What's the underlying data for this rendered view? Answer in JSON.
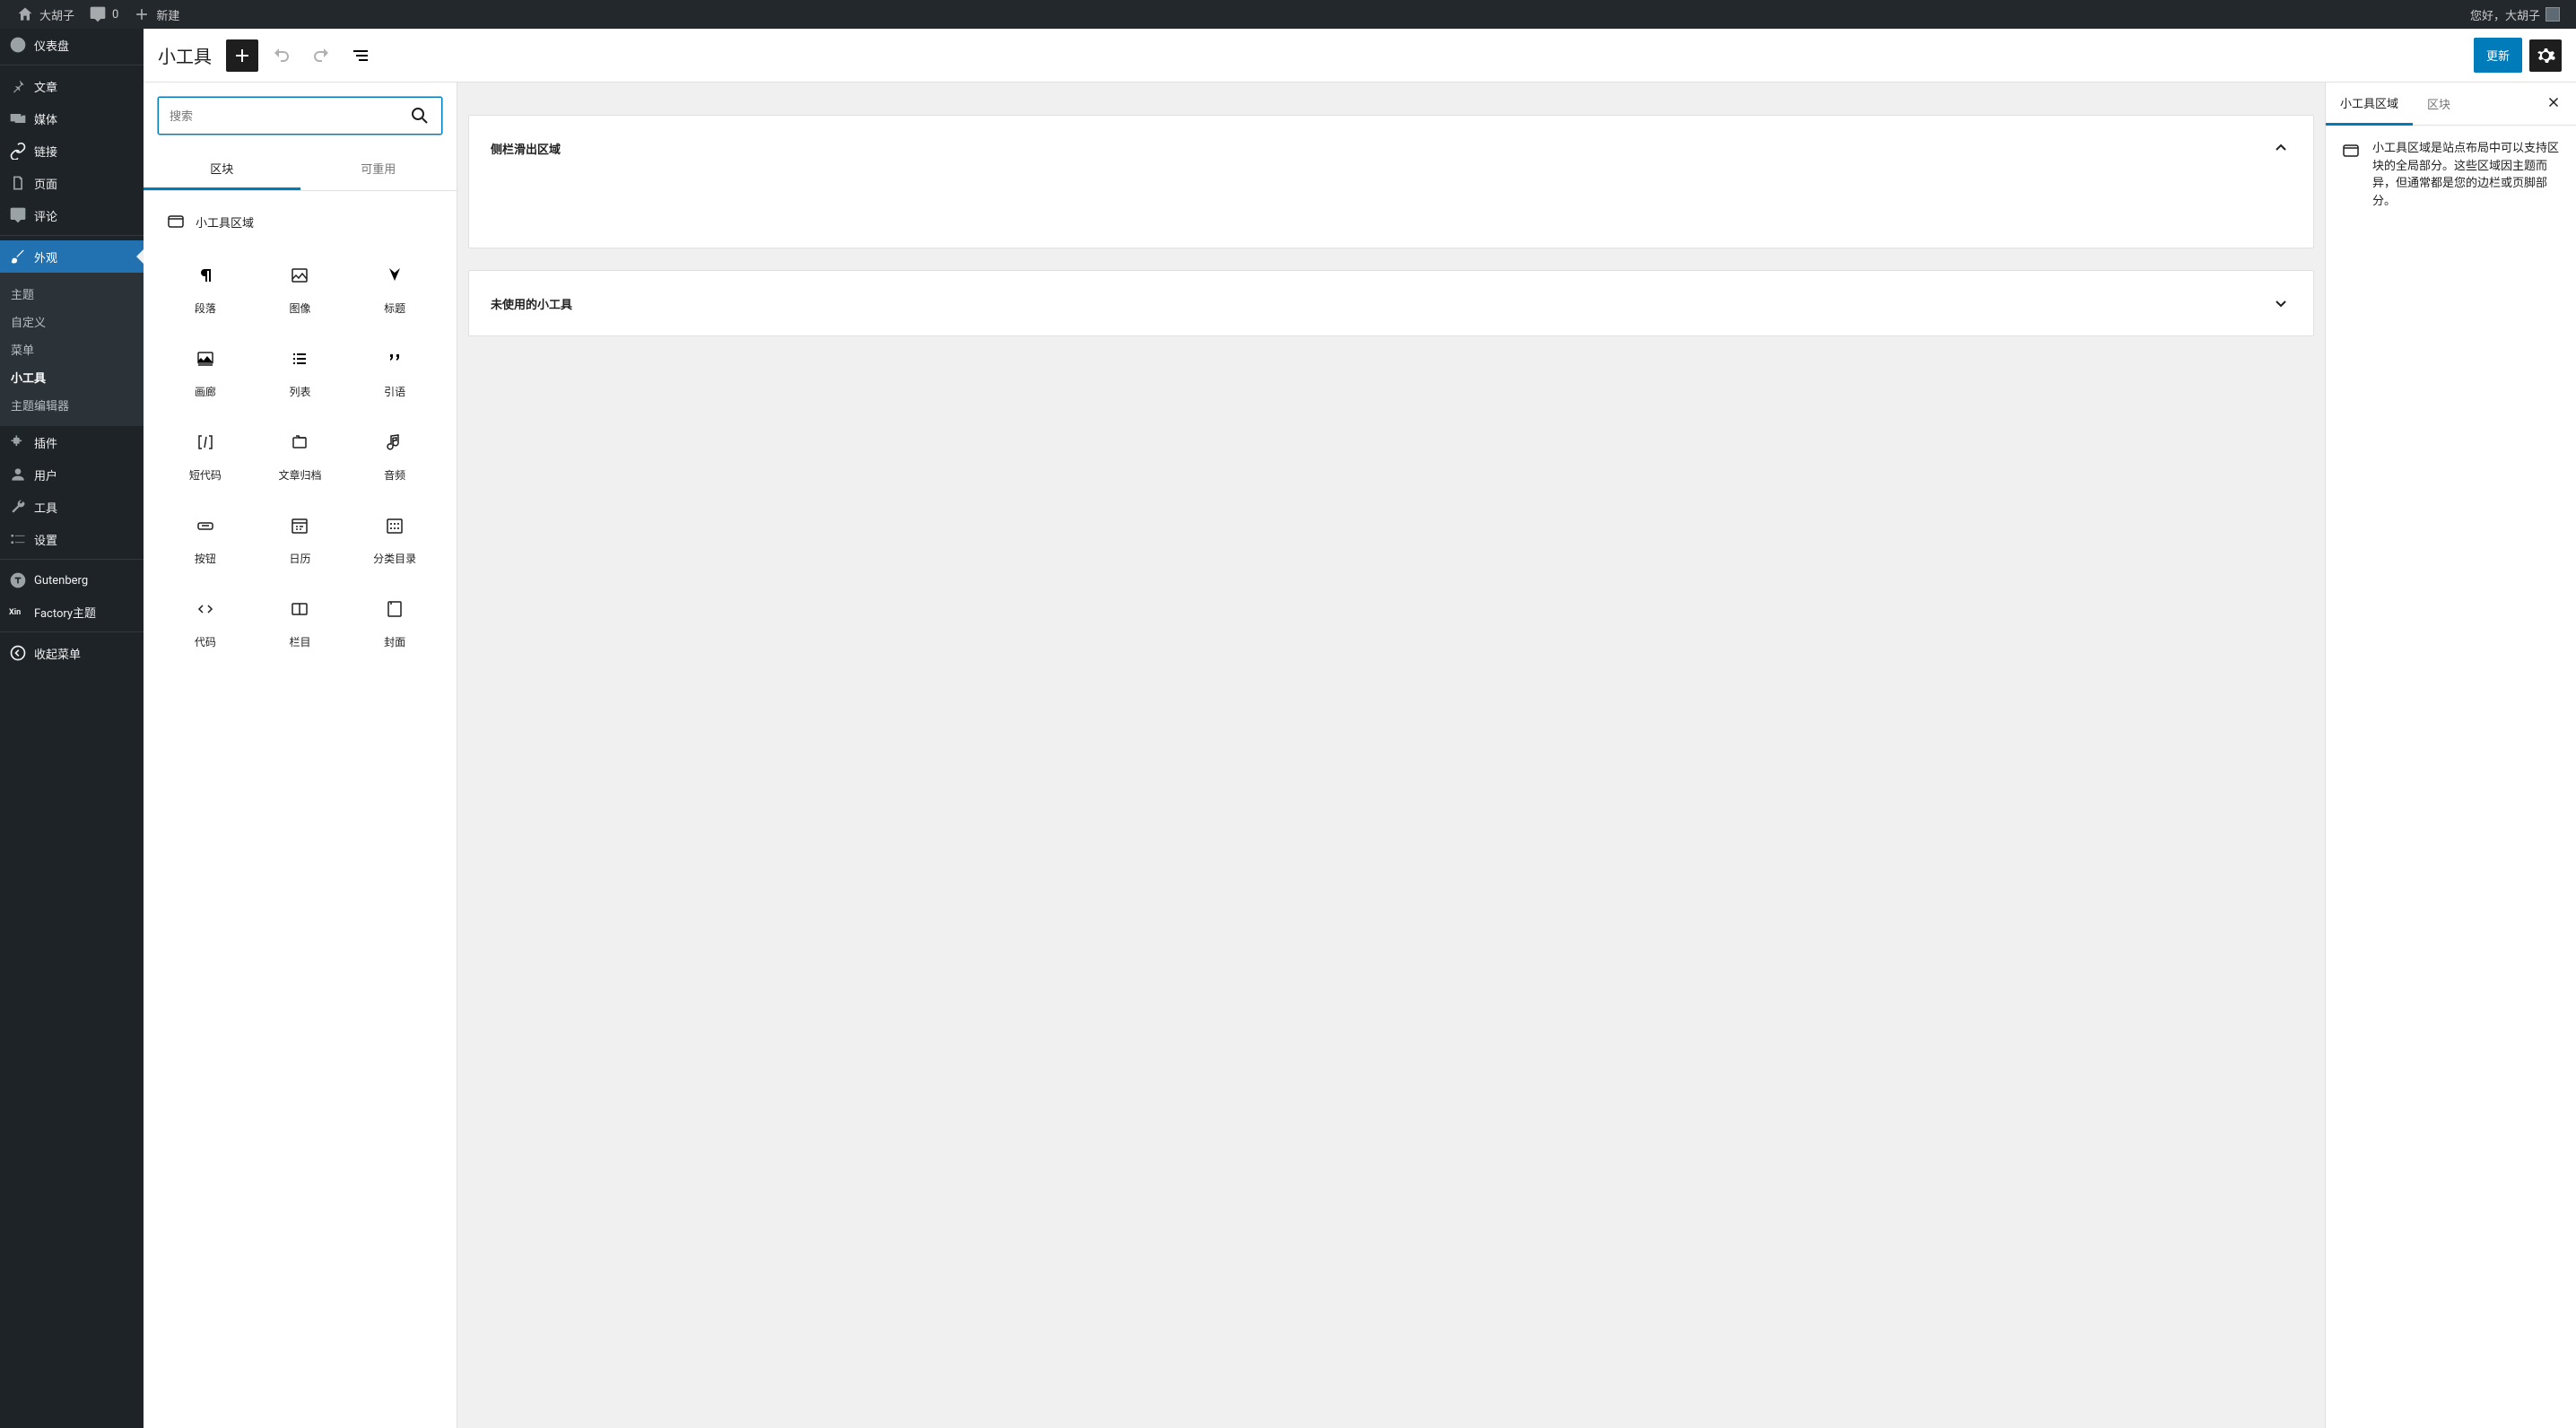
{
  "adminbar": {
    "site_name": "大胡子",
    "comments_count": "0",
    "new_label": "新建",
    "greeting": "您好，大胡子"
  },
  "sidebar": {
    "items": [
      {
        "id": "dashboard",
        "label": "仪表盘"
      },
      {
        "id": "posts",
        "label": "文章"
      },
      {
        "id": "media",
        "label": "媒体"
      },
      {
        "id": "links",
        "label": "链接"
      },
      {
        "id": "pages",
        "label": "页面"
      },
      {
        "id": "comments",
        "label": "评论"
      },
      {
        "id": "appearance",
        "label": "外观"
      },
      {
        "id": "plugins",
        "label": "插件"
      },
      {
        "id": "users",
        "label": "用户"
      },
      {
        "id": "tools",
        "label": "工具"
      },
      {
        "id": "settings",
        "label": "设置"
      },
      {
        "id": "gutenberg",
        "label": "Gutenberg"
      },
      {
        "id": "factory",
        "label": "Factory主题"
      },
      {
        "id": "collapse",
        "label": "收起菜单"
      }
    ],
    "appearance_sub": [
      {
        "id": "themes",
        "label": "主题"
      },
      {
        "id": "customize",
        "label": "自定义"
      },
      {
        "id": "menus",
        "label": "菜单"
      },
      {
        "id": "widgets",
        "label": "小工具"
      },
      {
        "id": "theme-editor",
        "label": "主题编辑器"
      }
    ]
  },
  "header": {
    "title": "小工具",
    "update_label": "更新"
  },
  "inserter": {
    "search_placeholder": "搜索",
    "tabs": {
      "blocks": "区块",
      "reusable": "可重用"
    },
    "category_label": "小工具区域",
    "blocks": [
      {
        "id": "paragraph",
        "label": "段落"
      },
      {
        "id": "image",
        "label": "图像"
      },
      {
        "id": "heading",
        "label": "标题"
      },
      {
        "id": "gallery",
        "label": "画廊"
      },
      {
        "id": "list",
        "label": "列表"
      },
      {
        "id": "quote",
        "label": "引语"
      },
      {
        "id": "shortcode",
        "label": "短代码"
      },
      {
        "id": "archives",
        "label": "文章归档"
      },
      {
        "id": "audio",
        "label": "音频"
      },
      {
        "id": "button",
        "label": "按钮"
      },
      {
        "id": "calendar",
        "label": "日历"
      },
      {
        "id": "categories",
        "label": "分类目录"
      },
      {
        "id": "code",
        "label": "代码"
      },
      {
        "id": "columns",
        "label": "栏目"
      },
      {
        "id": "cover",
        "label": "封面"
      }
    ]
  },
  "canvas": {
    "areas": [
      {
        "id": "sidebar-slide",
        "title": "侧栏滑出区域",
        "open": true
      },
      {
        "id": "inactive",
        "title": "未使用的小工具",
        "open": false
      }
    ]
  },
  "settings": {
    "tabs": {
      "area": "小工具区域",
      "block": "区块"
    },
    "desc": "小工具区域是站点布局中可以支持区块的全局部分。这些区域因主题而异，但通常都是您的边栏或页脚部分。"
  }
}
